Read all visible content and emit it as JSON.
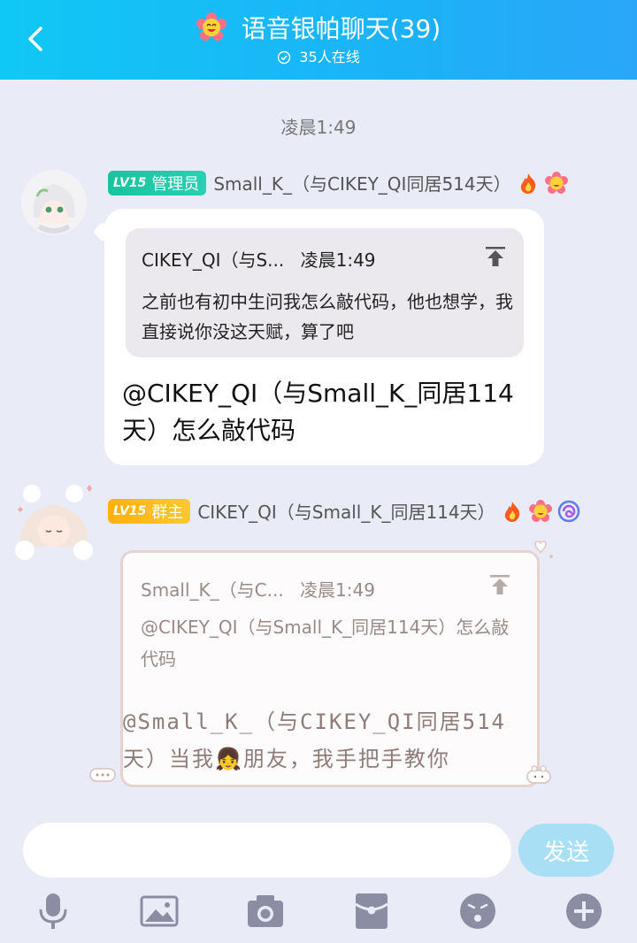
{
  "header": {
    "title": "语音银帕聊天(39)",
    "online": "35人在线"
  },
  "time_divider": "凌晨1:49",
  "messages": [
    {
      "badge_level": "LV15",
      "badge_role": "管理员",
      "sender": "Small_K_（与CIKEY_QI同居514天）",
      "quote": {
        "author": "CIKEY_QI（与S...",
        "time": "凌晨1:49",
        "text": "之前也有初中生问我怎么敲代码，他也想学，我直接说你没这天赋，算了吧"
      },
      "text": "@CIKEY_QI（与Small_K_同居114天）怎么敲代码"
    },
    {
      "badge_level": "LV15",
      "badge_role": "群主",
      "sender": "CIKEY_QI（与Small_K_同居114天）",
      "quote": {
        "author": "Small_K_（与C...",
        "time": "凌晨1:49",
        "text": "@CIKEY_QI（与Small_K_同居114天）怎么敲代码"
      },
      "text": "@Small_K_（与CIKEY_QI同居514天）当我👧朋友，我手把手教你"
    }
  ],
  "input": {
    "placeholder": ""
  },
  "send_label": "发送",
  "colors": {
    "header_start": "#10c8f5",
    "header_end": "#2aa6f8",
    "background": "#e9ebf6",
    "admin_badge": "#19c39e",
    "owner_badge": "#ffb10a",
    "send_button": "#a9dff5"
  },
  "toolbar_icons": [
    "microphone-icon",
    "image-icon",
    "camera-icon",
    "red-packet-icon",
    "emoji-icon",
    "plus-icon"
  ]
}
